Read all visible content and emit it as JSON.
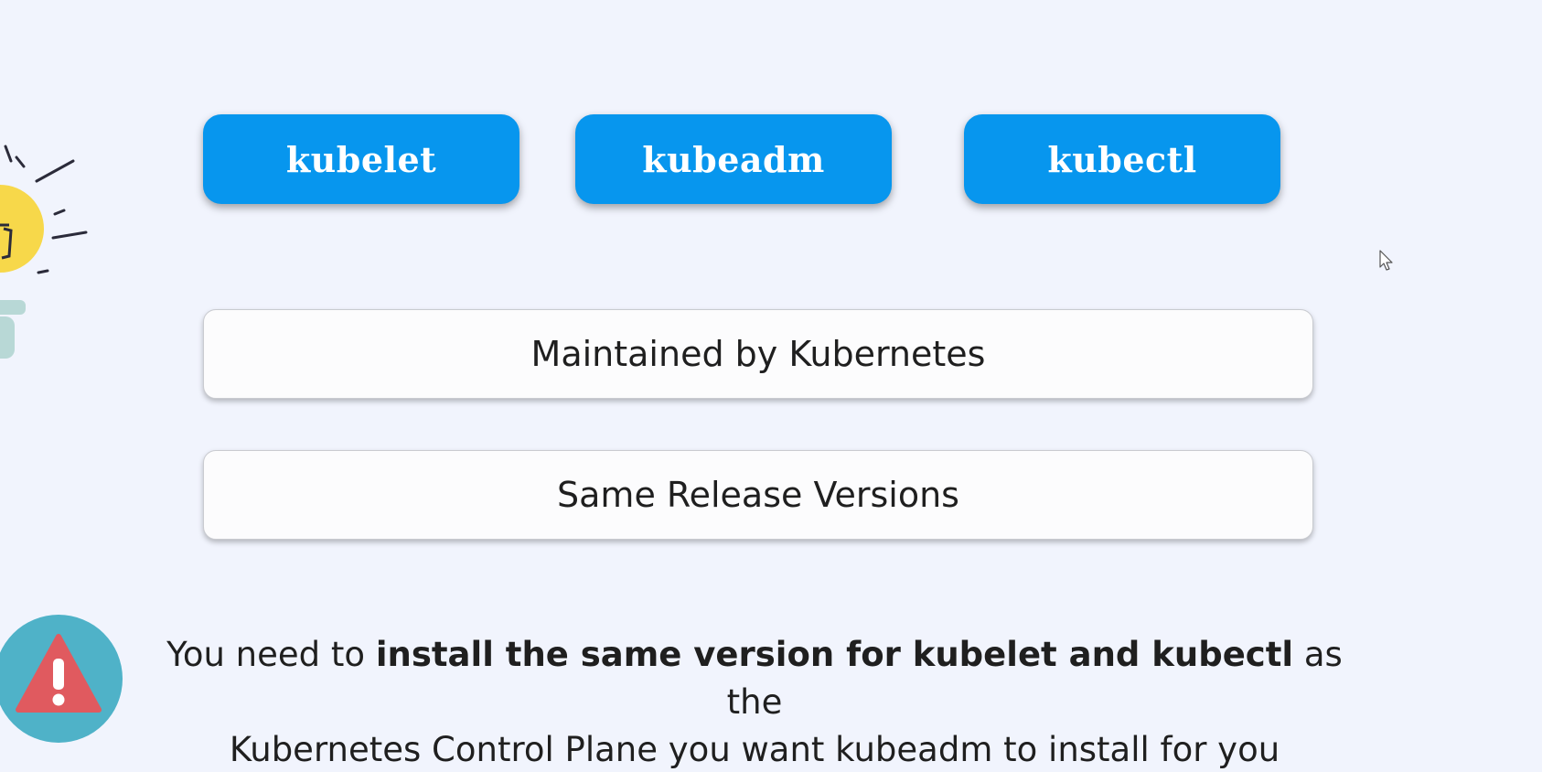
{
  "tools": [
    {
      "label": "kubelet"
    },
    {
      "label": "kubeadm"
    },
    {
      "label": "kubectl"
    }
  ],
  "facts": {
    "maintained": "Maintained by Kubernetes",
    "versions": "Same Release Versions"
  },
  "note": {
    "prefix": "You need to ",
    "bold": "install the same version for kubelet and kubectl",
    "suffix": " as the",
    "line2": "Kubernetes Control Plane you want kubeadm to install for you"
  },
  "colors": {
    "pill": "#0796ee",
    "background": "#f1f4fd",
    "warning_circle": "#4fb2c8",
    "warning_triangle": "#e05a5f",
    "bulb": "#f7d84a"
  },
  "icons": {
    "warning": "warning-icon",
    "bulb": "lightbulb-icon",
    "cursor": "mouse-cursor-icon"
  }
}
